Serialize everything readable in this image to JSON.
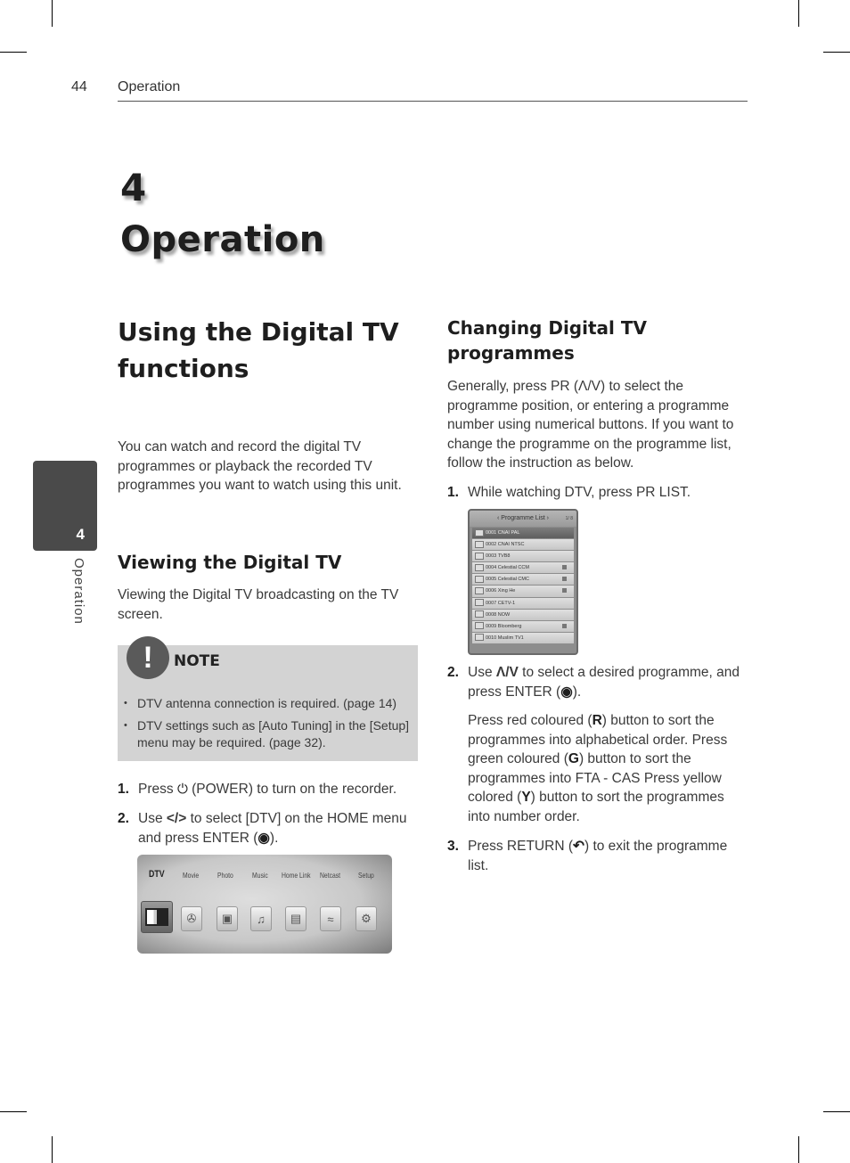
{
  "running_head": {
    "page_number": "44",
    "section": "Operation"
  },
  "chapter": {
    "number": "4",
    "title": "Operation"
  },
  "side_tab": {
    "number": "4",
    "label": "Operation"
  },
  "left_column": {
    "heading": "Using the Digital TV functions",
    "intro": "You can watch and record the digital TV programmes or playback the recorded TV programmes you want to watch using this unit.",
    "subheading": "Viewing the Digital TV",
    "sub_intro": "Viewing the Digital TV broadcasting on the TV screen.",
    "note": {
      "title": "NOTE",
      "icon": "exclamation-icon",
      "items": [
        "DTV antenna connection is required. (page 14)",
        "DTV settings such as [Auto Tuning] in the [Setup] menu may be required. (page 32)."
      ]
    },
    "steps": [
      {
        "num": "1.",
        "before": "Press ",
        "icon": "power-icon",
        "after": " (POWER) to turn on the recorder."
      },
      {
        "num": "2.",
        "before": "Use ",
        "keys": "</>",
        "middle": " to select [DTV] on the HOME menu and press ENTER (",
        "icon": "enter-icon",
        "after": ")."
      }
    ],
    "home_menu": {
      "items": [
        "DTV",
        "Movie",
        "Photo",
        "Music",
        "Home Link",
        "Netcast",
        "Setup"
      ],
      "selected": "DTV"
    }
  },
  "right_column": {
    "heading": "Changing Digital TV programmes",
    "intro": "Generally, press PR (Λ/V) to select the programme position, or entering a programme number using numerical buttons. If you want to change the programme on the programme list, follow the instruction as below.",
    "steps": [
      {
        "num": "1.",
        "text": "While watching DTV, press PR LIST."
      },
      {
        "num": "2.",
        "before": "Use ",
        "keys": "Λ/V",
        "middle": " to select a desired programme, and press ENTER (",
        "icon": "enter-icon",
        "after": ")."
      },
      {
        "num": "3.",
        "before": "Press RETURN (",
        "icon": "return-icon",
        "after": ") to exit the programme list."
      }
    ],
    "step2_detail": {
      "p1": "Press red coloured (",
      "r": "R",
      "p2": ") button to sort the programmes into alphabetical order. Press green coloured (",
      "g": "G",
      "p3": ") button to sort the programmes into FTA - CAS Press yellow colored (",
      "y": "Y",
      "p4": ") button to sort the programmes into number order."
    },
    "programme_list": {
      "title": "Programme List",
      "page": "1/ 8",
      "rows": [
        {
          "num": "0001",
          "name": "CNAI PAL",
          "locked": false,
          "selected": true
        },
        {
          "num": "0002",
          "name": "CNAI NTSC",
          "locked": false,
          "selected": false
        },
        {
          "num": "0003",
          "name": "TVB8",
          "locked": false,
          "selected": false
        },
        {
          "num": "0004",
          "name": "Celestial CCM",
          "locked": true,
          "selected": false
        },
        {
          "num": "0005",
          "name": "Celestial CMC",
          "locked": true,
          "selected": false
        },
        {
          "num": "0006",
          "name": "Xing He",
          "locked": true,
          "selected": false
        },
        {
          "num": "0007",
          "name": "CETV-1",
          "locked": false,
          "selected": false
        },
        {
          "num": "0008",
          "name": "NOW",
          "locked": false,
          "selected": false
        },
        {
          "num": "0009",
          "name": "Bloomberg",
          "locked": true,
          "selected": false
        },
        {
          "num": "0010",
          "name": "Muslim TV1",
          "locked": false,
          "selected": false
        }
      ]
    }
  }
}
